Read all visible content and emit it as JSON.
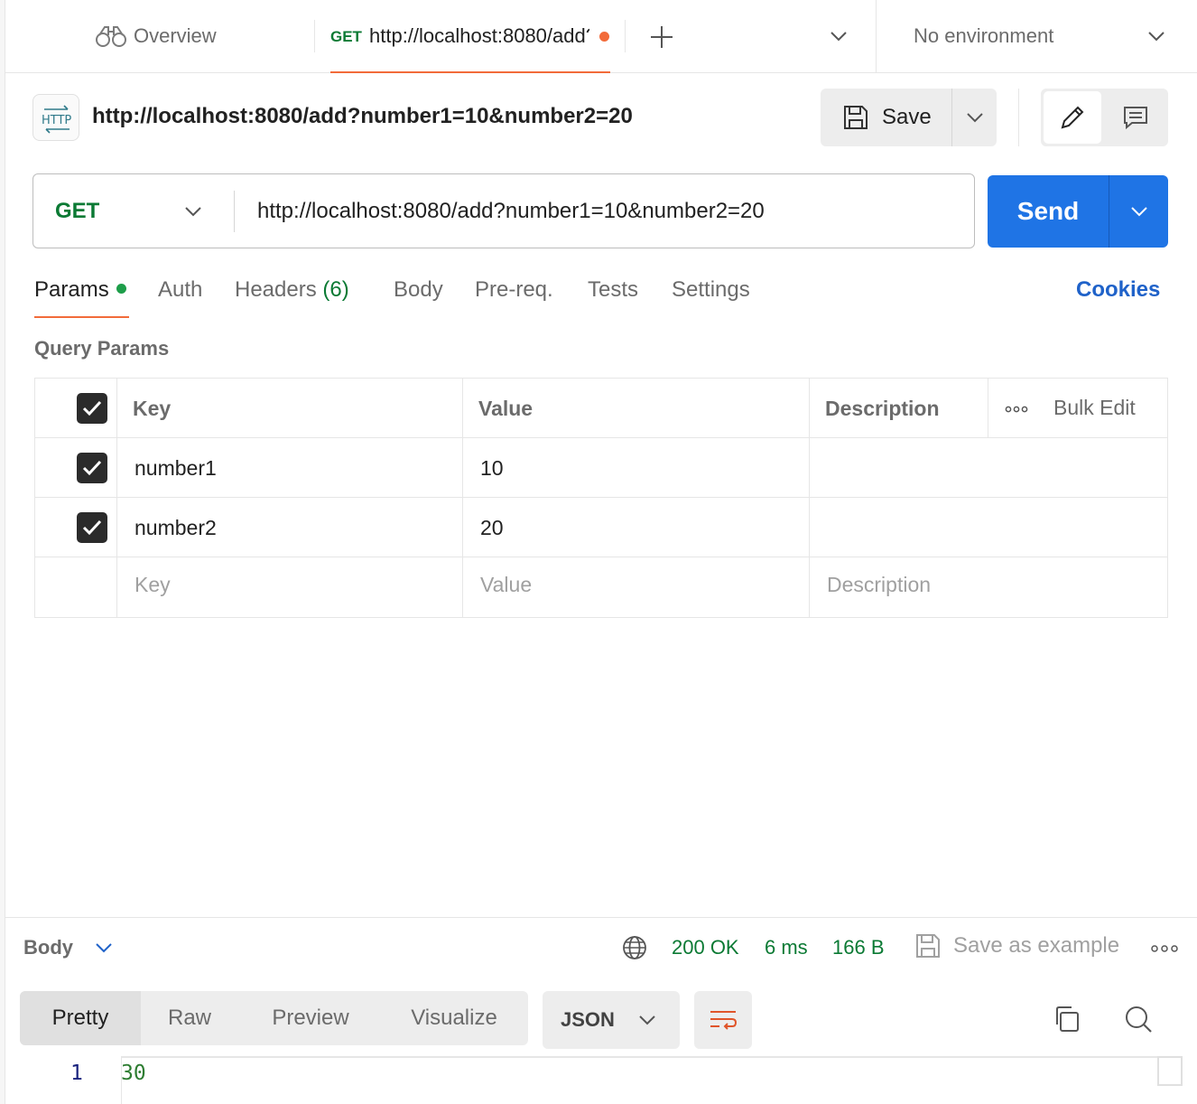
{
  "tabs": {
    "overview_label": "Overview",
    "active_method": "GET",
    "active_url": "http://localhost:8080/add?number1=10&number2=20",
    "environment": "No environment"
  },
  "request": {
    "title": "http://localhost:8080/add?number1=10&number2=20",
    "icon_text": "HTTP",
    "save_label": "Save",
    "method": "GET",
    "url": "http://localhost:8080/add?number1=10&number2=20",
    "send_label": "Send"
  },
  "param_tabs": {
    "params": "Params",
    "auth": "Auth",
    "headers": "Headers",
    "headers_count": "(6)",
    "body": "Body",
    "prereq": "Pre-req.",
    "tests": "Tests",
    "settings": "Settings",
    "cookies": "Cookies"
  },
  "query_params": {
    "label": "Query Params",
    "headers": {
      "key": "Key",
      "value": "Value",
      "description": "Description",
      "bulk_edit": "Bulk Edit"
    },
    "rows": [
      {
        "key": "number1",
        "value": "10",
        "description": "",
        "checked": true
      },
      {
        "key": "number2",
        "value": "20",
        "description": "",
        "checked": true
      }
    ],
    "placeholders": {
      "key": "Key",
      "value": "Value",
      "description": "Description"
    }
  },
  "response": {
    "section_label": "Body",
    "status": "200 OK",
    "time": "6 ms",
    "size": "166 B",
    "save_example": "Save as example",
    "views": [
      "Pretty",
      "Raw",
      "Preview",
      "Visualize"
    ],
    "active_view": "Pretty",
    "format": "JSON",
    "line_number": "1",
    "body_text": "30"
  },
  "colors": {
    "accent": "#f26b3a",
    "send": "#1f74e5",
    "method_green": "#0b7a34",
    "link_blue": "#1f62c9"
  }
}
